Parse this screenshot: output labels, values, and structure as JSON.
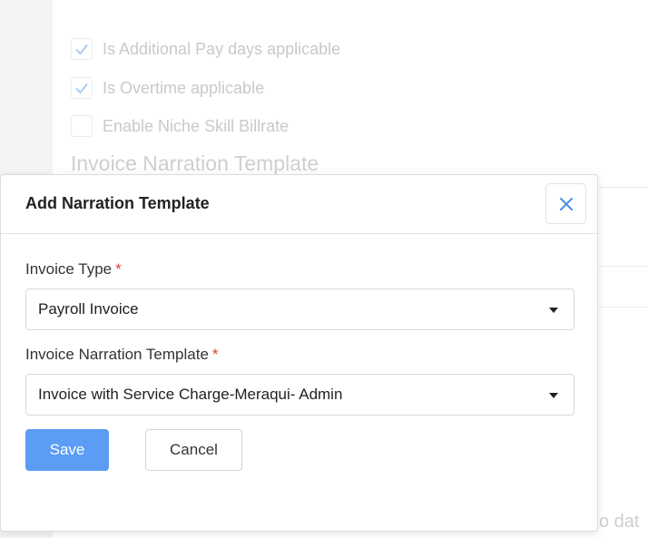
{
  "background": {
    "checkboxes": [
      {
        "label": "Is Additional Pay days applicable",
        "checked": true
      },
      {
        "label": "Is Overtime applicable",
        "checked": true
      },
      {
        "label": "Enable Niche Skill Billrate",
        "checked": false
      }
    ],
    "section_title": "Invoice Narration Template",
    "no_data_text": "o dat"
  },
  "modal": {
    "title": "Add Narration Template",
    "close_icon": "close-icon",
    "invoice_type": {
      "label": "Invoice Type",
      "required_mark": "*",
      "value": "Payroll Invoice"
    },
    "narration_template": {
      "label": "Invoice Narration Template",
      "required_mark": "*",
      "value": "Invoice with Service Charge-Meraqui- Admin"
    },
    "save_label": "Save",
    "cancel_label": "Cancel"
  },
  "colors": {
    "accent": "#5b9df5",
    "required": "#d9443c",
    "close_icon": "#4a90e2"
  }
}
